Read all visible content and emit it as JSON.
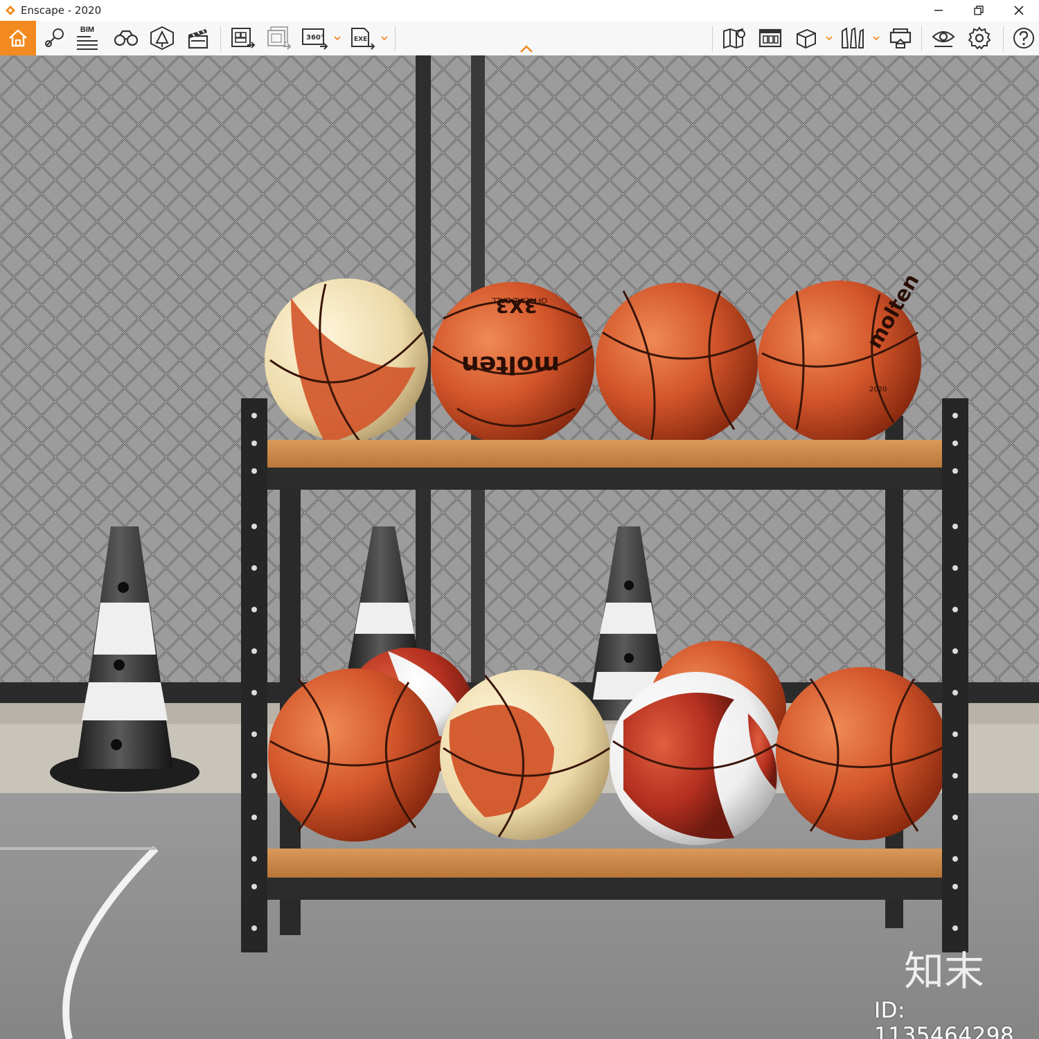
{
  "window": {
    "title": "Enscape - 2020",
    "controls": [
      "minimize",
      "restore",
      "close"
    ]
  },
  "toolbar": {
    "bim_label": "BIM",
    "badge_360": "360°",
    "badge_exe": "EXE",
    "accent_color": "#f28a1f",
    "left_icons": [
      "home-icon",
      "pin-icon",
      "bim-icon",
      "binoculars-icon",
      "asset-library-icon",
      "clapperboard-icon"
    ],
    "export_icons": [
      "render-export-icon",
      "batch-render-icon",
      "panorama-360-icon",
      "exe-export-icon"
    ],
    "right_icons": [
      "map-icon",
      "timeline-icon",
      "box-view-icon",
      "perspective-icon",
      "vr-headset-icon",
      "eye-icon",
      "gear-icon",
      "help-icon"
    ]
  },
  "viewport": {
    "description_colors": {
      "fence": "#8f8f8f",
      "shelf_wood": "#c9874a",
      "ball": "#d2552a",
      "floor": "#8c8c8c"
    },
    "ball_texts": [
      "3X3",
      "molten",
      "OFFICIAL BALL",
      "2020"
    ],
    "watermark": {
      "brand": "知末",
      "id_text": "ID: 1135464298"
    }
  }
}
